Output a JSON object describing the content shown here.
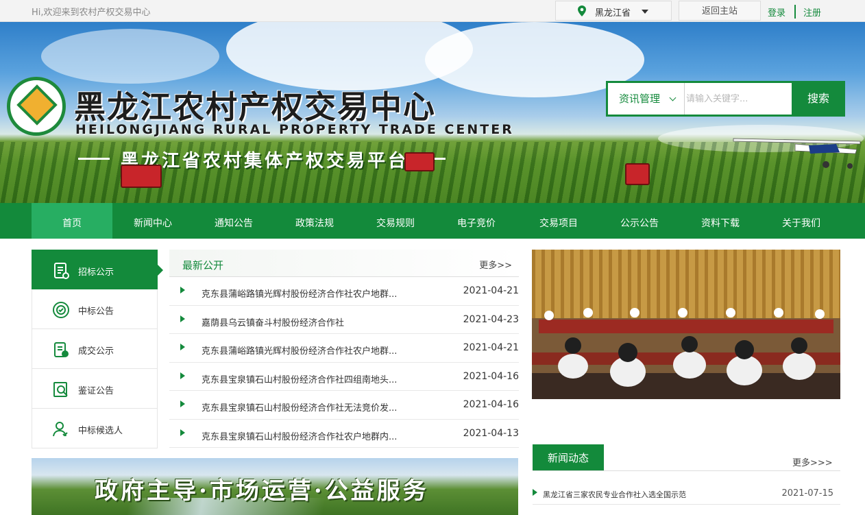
{
  "topbar": {
    "welcome": "Hi,欢迎来到农村产权交易中心",
    "region": "黑龙江省",
    "back_home": "返回主站",
    "login": "登录",
    "register": "注册"
  },
  "banner": {
    "title": "黑龙江农村产权交易中心",
    "subtitle_en": "HEILONGJIANG RURAL PROPERTY TRADE CENTER",
    "platform": "黑龙江省农村集体产权交易平台"
  },
  "search": {
    "category": "资讯管理",
    "placeholder": "请输入关键字...",
    "button": "搜索"
  },
  "nav": {
    "items": [
      "首页",
      "新闻中心",
      "通知公告",
      "政策法规",
      "交易规则",
      "电子竞价",
      "交易项目",
      "公示公告",
      "资料下载",
      "关于我们"
    ]
  },
  "sidemenu": {
    "items": [
      {
        "label": "招标公示",
        "icon": "document-list-icon"
      },
      {
        "label": "中标公告",
        "icon": "award-badge-icon"
      },
      {
        "label": "成交公示",
        "icon": "clipboard-check-icon"
      },
      {
        "label": "鉴证公告",
        "icon": "certificate-search-icon"
      },
      {
        "label": "中标候选人",
        "icon": "user-check-icon"
      }
    ]
  },
  "latest": {
    "title": "最新公开",
    "more": "更多>>",
    "rows": [
      {
        "text": "克东县蒲峪路镇光辉村股份经济合作社农户地群...",
        "date": "2021-04-21"
      },
      {
        "text": "嘉荫县乌云镇奋斗村股份经济合作社",
        "date": "2021-04-23"
      },
      {
        "text": "克东县蒲峪路镇光辉村股份经济合作社农户地群...",
        "date": "2021-04-21"
      },
      {
        "text": "克东县宝泉镇石山村股份经济合作社四组南地头...",
        "date": "2021-04-16"
      },
      {
        "text": "克东县宝泉镇石山村股份经济合作社无法竞价发...",
        "date": "2021-04-16"
      },
      {
        "text": "克东县宝泉镇石山村股份经济合作社农户地群内...",
        "date": "2021-04-13"
      }
    ]
  },
  "landscape": {
    "slogan": "政府主导·市场运营·公益服务"
  },
  "news": {
    "tab": "新闻动态",
    "more": "更多>>>",
    "rows": [
      {
        "text": "黑龙江省三家农民专业合作社入选全国示范",
        "date": "2021-07-15"
      }
    ]
  },
  "colors": {
    "brand_green": "#138a3b",
    "nav_active": "#27ae62"
  }
}
